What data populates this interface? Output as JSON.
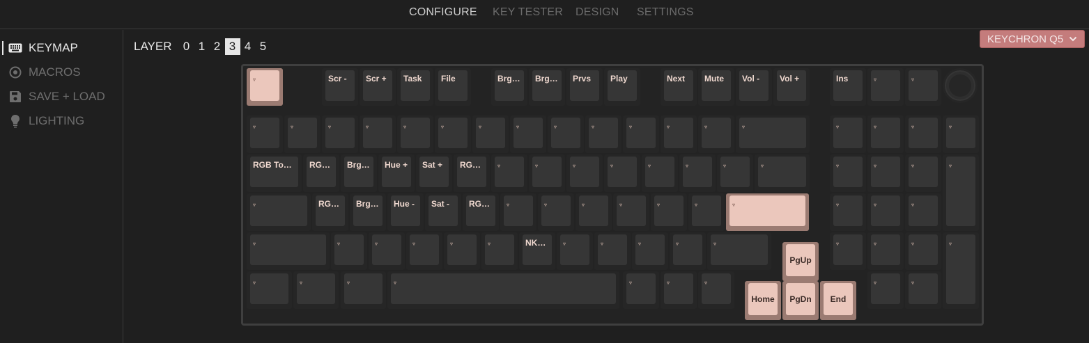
{
  "nav": {
    "tabs": [
      {
        "label": "CONFIGURE",
        "active": true
      },
      {
        "label": "KEY TESTER",
        "active": false
      },
      {
        "label": "DESIGN",
        "active": false
      },
      {
        "label": "SETTINGS",
        "active": false
      }
    ]
  },
  "sidebar": {
    "items": [
      {
        "label": "KEYMAP",
        "icon": "keyboard-icon",
        "active": true
      },
      {
        "label": "MACROS",
        "icon": "record-icon",
        "active": false
      },
      {
        "label": "SAVE + LOAD",
        "icon": "floppy-icon",
        "active": false
      },
      {
        "label": "LIGHTING",
        "icon": "lightbulb-icon",
        "active": false
      }
    ]
  },
  "layers": {
    "label": "LAYER",
    "options": [
      "0",
      "1",
      "2",
      "3",
      "4",
      "5"
    ],
    "selected": "3"
  },
  "keyboard_select": {
    "value": "KEYCHRON Q5"
  },
  "colors": {
    "accent": "#c47c7c",
    "highlight_key": "#ebc7bc",
    "key": "#363636",
    "background": "#1f1f1f"
  },
  "keys": {
    "transparent": "▿",
    "row0": [
      "▿",
      "Scr -",
      "Scr +",
      "Task",
      "File",
      "Brght-",
      "Brght+",
      "Prvs",
      "Play",
      "Next",
      "Mute",
      "Vol -",
      "Vol +",
      "Ins",
      "▿",
      "▿"
    ],
    "row1": [
      "▿",
      "▿",
      "▿",
      "▿",
      "▿",
      "▿",
      "▿",
      "▿",
      "▿",
      "▿",
      "▿",
      "▿",
      "▿",
      "▿",
      "▿",
      "▿",
      "▿",
      "▿"
    ],
    "row2": [
      "RGB Tog…",
      "RGB…",
      "Brght+",
      "Hue +",
      "Sat +",
      "RGB…",
      "▿",
      "▿",
      "▿",
      "▿",
      "▿",
      "▿",
      "▿",
      "▿",
      "▿",
      "▿",
      "▿",
      "▿"
    ],
    "row3": [
      "▿",
      "RGB…",
      "Brght-",
      "Hue -",
      "Sat -",
      "RGB…",
      "▿",
      "▿",
      "▿",
      "▿",
      "▿",
      "▿",
      "▿",
      "▿",
      "▿",
      "▿"
    ],
    "row4": [
      "▿",
      "▿",
      "▿",
      "▿",
      "▿",
      "▿",
      "NKRO",
      "▿",
      "▿",
      "▿",
      "▿",
      "▿",
      "PgUp",
      "▿",
      "▿",
      "▿",
      "▿"
    ],
    "row5": [
      "▿",
      "▿",
      "▿",
      "▿",
      "▿",
      "▿",
      "▿",
      "Home",
      "PgDn",
      "End",
      "▿",
      "▿"
    ]
  }
}
